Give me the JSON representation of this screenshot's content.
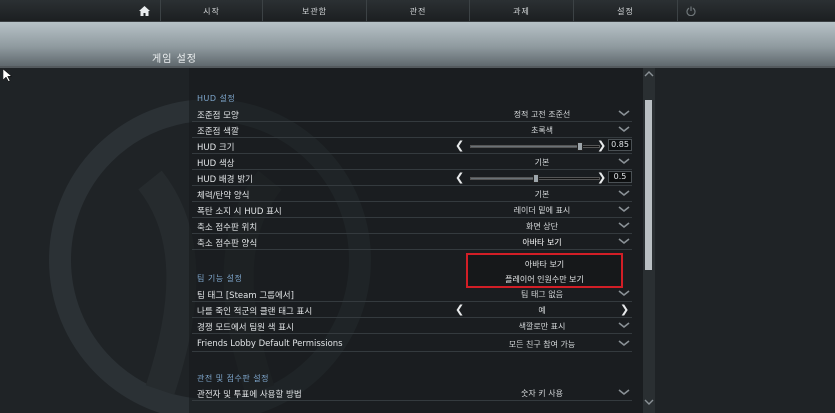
{
  "nav": {
    "items": [
      "시작",
      "보관함",
      "관전",
      "과제",
      "설정"
    ],
    "home_icon": "home-icon",
    "power_icon": "power-icon"
  },
  "page_title": "게임 설정",
  "sections": {
    "hud": "HUD 설정",
    "team": "팀 기능 설정",
    "spectator": "관전 및 점수판 설정"
  },
  "hud_rows": [
    {
      "label": "조준점 모양",
      "value": "정적 고전 조준선"
    },
    {
      "label": "조준점 색깔",
      "value": "초록색"
    },
    {
      "label": "HUD 크기",
      "value": "0.85",
      "slider": 0.85
    },
    {
      "label": "HUD 색상",
      "value": "기본"
    },
    {
      "label": "HUD 배경 밝기",
      "value": "0.5",
      "slider": 0.5
    },
    {
      "label": "체력/탄약 양식",
      "value": "기본"
    },
    {
      "label": "폭탄 소지 시 HUD 표시",
      "value": "레이더 밑에 표시"
    },
    {
      "label": "축소 점수판 위치",
      "value": "화면 상단"
    },
    {
      "label": "축소 점수판 양식",
      "value": "아바타 보기"
    }
  ],
  "dropdown_options": [
    "아바타 보기",
    "플레이어 인원수만 보기"
  ],
  "team_rows": [
    {
      "label": "팀 태그 [Steam 그룹에서]",
      "value": "팀 태그 없음"
    },
    {
      "label": "나를 죽인 적군의 클랜 태그 표시",
      "value": "예"
    },
    {
      "label": "경쟁 모드에서 팀원 색 표시",
      "value": "색깔로만 표시"
    },
    {
      "label": "Friends Lobby Default Permissions",
      "value": "모든 친구 참여 가능"
    }
  ],
  "spectator_rows": [
    {
      "label": "관전자 및 투표에 사용할 방법",
      "value": "숫자 키 사용"
    }
  ],
  "colors": {
    "accent_blue": "#7fa7cd",
    "highlight_red": "#d21e26"
  }
}
